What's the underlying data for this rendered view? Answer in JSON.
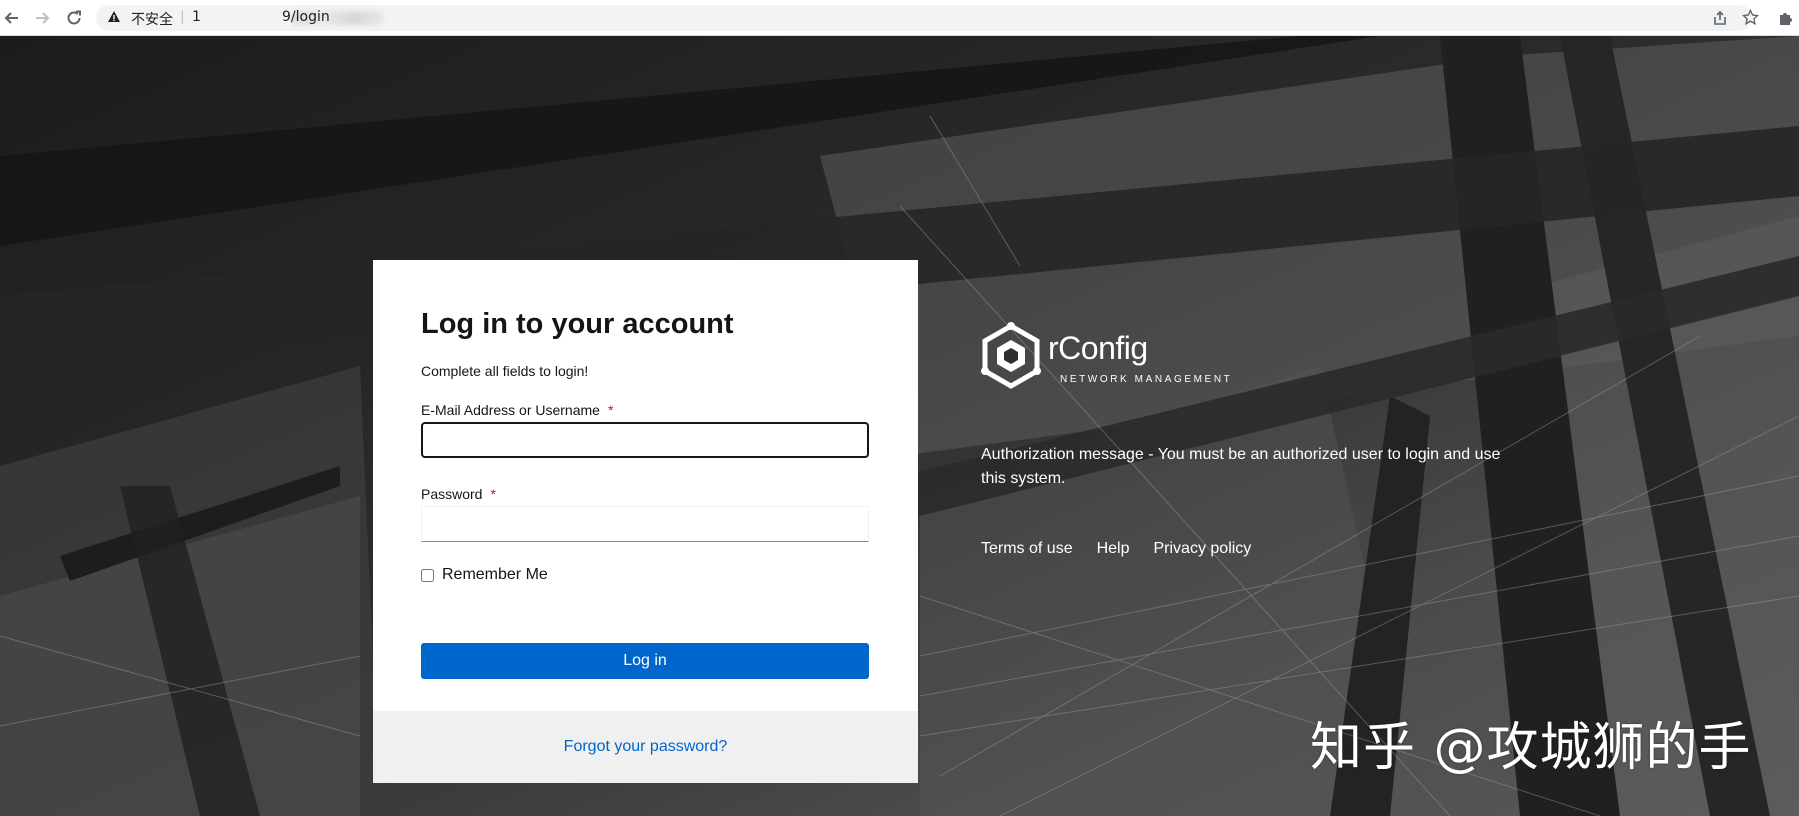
{
  "browser": {
    "url_prefix": "1",
    "security_label": "不安全",
    "url_suffix": "9/login"
  },
  "login_card": {
    "title": "Log in to your account",
    "subtitle": "Complete all fields to login!",
    "username_label": "E-Mail Address or Username",
    "username_value": "",
    "password_label": "Password",
    "password_value": "",
    "required_marker": "*",
    "remember_label": "Remember Me",
    "remember_checked": false,
    "submit_label": "Log in",
    "forgot_label": "Forgot your password?"
  },
  "brand": {
    "name": "rConfig",
    "tagline": "NETWORK MANAGEMENT"
  },
  "info": {
    "auth_message": "Authorization message - You must be an authorized user to login and use this system."
  },
  "footer_links": [
    {
      "label": "Terms of use"
    },
    {
      "label": "Help"
    },
    {
      "label": "Privacy policy"
    }
  ],
  "watermark": "知乎 @攻城狮的手",
  "colors": {
    "primary": "#0066cc",
    "required": "#c9190b",
    "card_footer": "#f0f0f0"
  },
  "icons": {
    "back": "arrow-left-icon",
    "forward": "arrow-right-icon",
    "reload": "reload-icon",
    "warning": "warning-icon",
    "share": "share-icon",
    "bookmark": "star-icon",
    "extensions": "puzzle-icon",
    "logo": "rconfig-logo-icon"
  }
}
